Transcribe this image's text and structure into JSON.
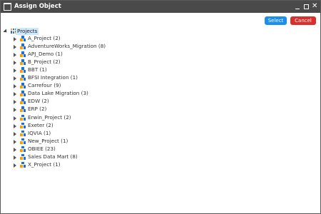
{
  "window": {
    "title": "Assign Object",
    "controls": {
      "minimize": "_",
      "maximize": "□",
      "close": "✕"
    }
  },
  "buttons": {
    "select_label": "Select",
    "cancel_label": "Cancel",
    "select_color": "#1b8ef0",
    "cancel_color": "#d9302b"
  },
  "tree": {
    "root": {
      "label": "Projects",
      "expanded": true,
      "selected": true
    },
    "items": [
      {
        "label": "A_Project (2)"
      },
      {
        "label": "AdventureWorks_Migration (8)"
      },
      {
        "label": "APJ_Demo (1)"
      },
      {
        "label": "B_Project (2)"
      },
      {
        "label": "BBT (1)"
      },
      {
        "label": "BFSI Integration (1)"
      },
      {
        "label": "Carrefour (9)"
      },
      {
        "label": "Data Lake Migration (3)"
      },
      {
        "label": "EDW (2)"
      },
      {
        "label": "ERP (2)"
      },
      {
        "label": "Erwin_Project (2)"
      },
      {
        "label": "Exeter (2)"
      },
      {
        "label": "IQVIA (1)"
      },
      {
        "label": "New_Project (1)"
      },
      {
        "label": "OBIEE (23)"
      },
      {
        "label": "Sales Data Mart (8)"
      },
      {
        "label": "X_Project (1)"
      }
    ]
  }
}
